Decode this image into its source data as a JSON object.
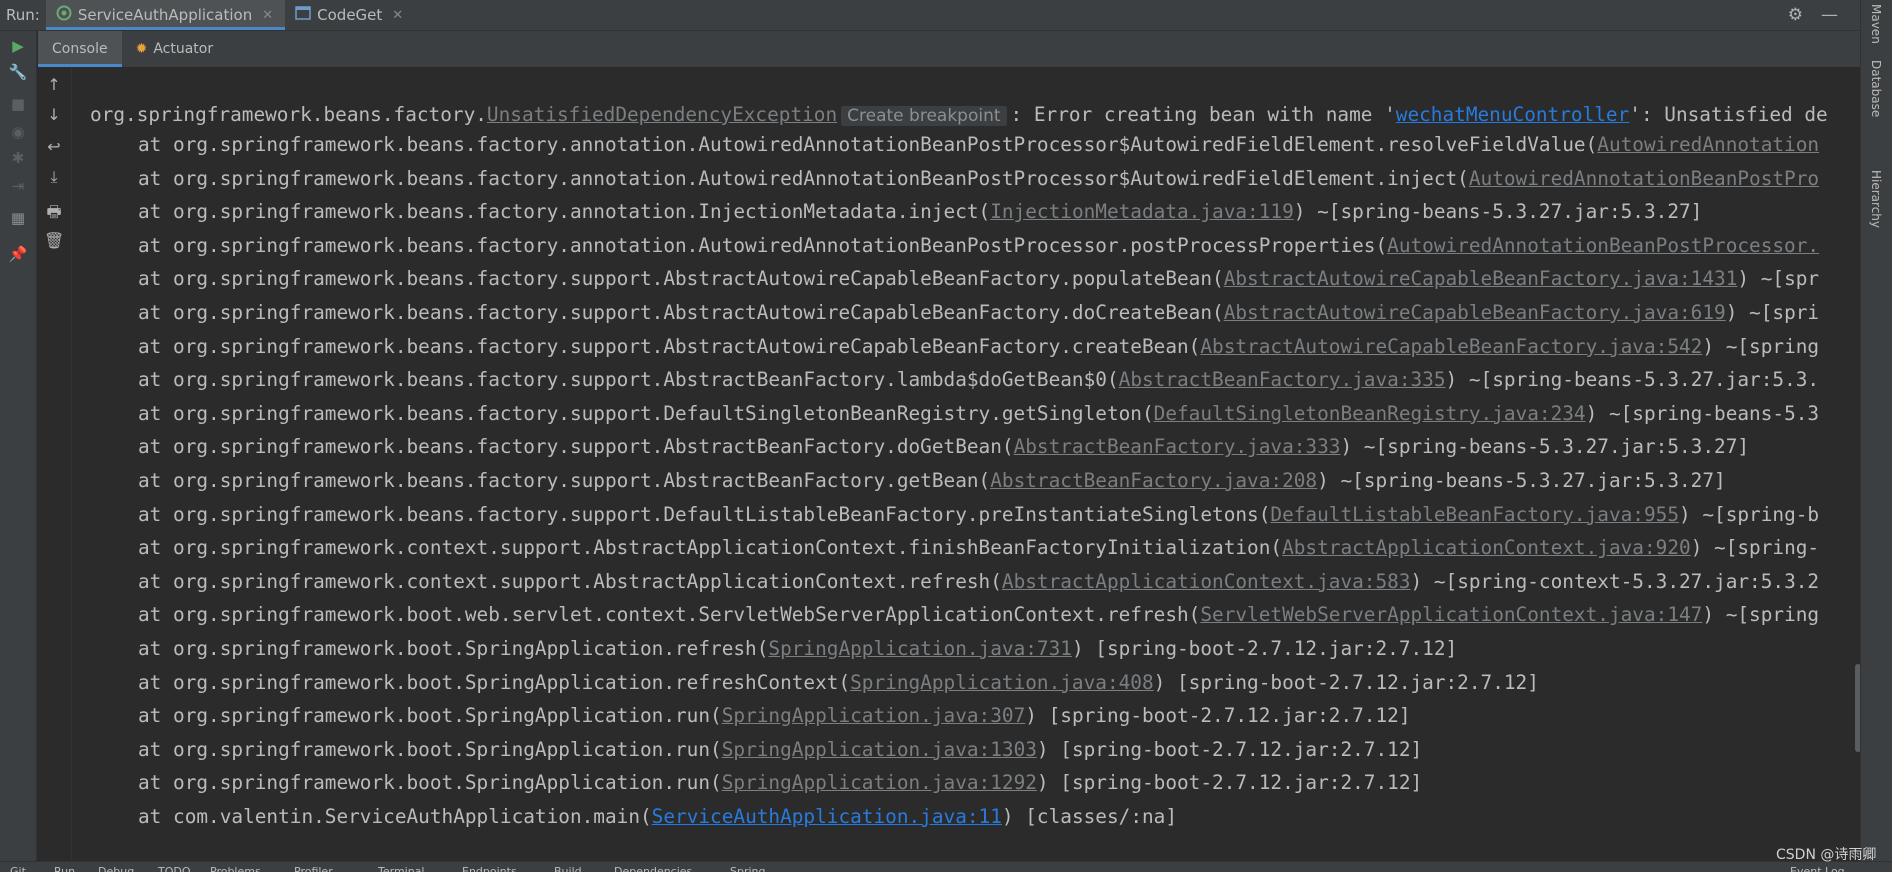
{
  "runbar": {
    "label": "Run:",
    "tabs": [
      {
        "label": "ServiceAuthApplication",
        "active": true
      },
      {
        "label": "CodeGet",
        "active": false
      }
    ]
  },
  "subtabs": [
    {
      "label": "Console",
      "active": true
    },
    {
      "label": "Actuator",
      "active": false
    }
  ],
  "right_stripe": [
    "Maven",
    "Database",
    "Hierarchy"
  ],
  "console": {
    "tooltip": "Create breakpoint",
    "first_line": {
      "prefix": "org.springframework.beans.factory.",
      "exception_link": "UnsatisfiedDependencyException",
      "mid": ": Error creating bean with name '",
      "bean_link": "wechatMenuController",
      "suffix": "': Unsatisfied de"
    },
    "stack": [
      {
        "at": "at org.springframework.beans.factory.annotation.AutowiredAnnotationBeanPostProcessor$AutowiredFieldElement.resolveFieldValue(",
        "link": "AutowiredAnnotation",
        "rest": ""
      },
      {
        "at": "at org.springframework.beans.factory.annotation.AutowiredAnnotationBeanPostProcessor$AutowiredFieldElement.inject(",
        "link": "AutowiredAnnotationBeanPostPro",
        "rest": ""
      },
      {
        "at": "at org.springframework.beans.factory.annotation.InjectionMetadata.inject(",
        "link": "InjectionMetadata.java:119",
        "rest": ") ~[spring-beans-5.3.27.jar:5.3.27]"
      },
      {
        "at": "at org.springframework.beans.factory.annotation.AutowiredAnnotationBeanPostProcessor.postProcessProperties(",
        "link": "AutowiredAnnotationBeanPostProcessor.",
        "rest": ""
      },
      {
        "at": "at org.springframework.beans.factory.support.AbstractAutowireCapableBeanFactory.populateBean(",
        "link": "AbstractAutowireCapableBeanFactory.java:1431",
        "rest": ") ~[spr"
      },
      {
        "at": "at org.springframework.beans.factory.support.AbstractAutowireCapableBeanFactory.doCreateBean(",
        "link": "AbstractAutowireCapableBeanFactory.java:619",
        "rest": ") ~[spri"
      },
      {
        "at": "at org.springframework.beans.factory.support.AbstractAutowireCapableBeanFactory.createBean(",
        "link": "AbstractAutowireCapableBeanFactory.java:542",
        "rest": ") ~[spring"
      },
      {
        "at": "at org.springframework.beans.factory.support.AbstractBeanFactory.lambda$doGetBean$0(",
        "link": "AbstractBeanFactory.java:335",
        "rest": ") ~[spring-beans-5.3.27.jar:5.3."
      },
      {
        "at": "at org.springframework.beans.factory.support.DefaultSingletonBeanRegistry.getSingleton(",
        "link": "DefaultSingletonBeanRegistry.java:234",
        "rest": ") ~[spring-beans-5.3"
      },
      {
        "at": "at org.springframework.beans.factory.support.AbstractBeanFactory.doGetBean(",
        "link": "AbstractBeanFactory.java:333",
        "rest": ") ~[spring-beans-5.3.27.jar:5.3.27]"
      },
      {
        "at": "at org.springframework.beans.factory.support.AbstractBeanFactory.getBean(",
        "link": "AbstractBeanFactory.java:208",
        "rest": ") ~[spring-beans-5.3.27.jar:5.3.27]"
      },
      {
        "at": "at org.springframework.beans.factory.support.DefaultListableBeanFactory.preInstantiateSingletons(",
        "link": "DefaultListableBeanFactory.java:955",
        "rest": ") ~[spring-b"
      },
      {
        "at": "at org.springframework.context.support.AbstractApplicationContext.finishBeanFactoryInitialization(",
        "link": "AbstractApplicationContext.java:920",
        "rest": ") ~[spring-"
      },
      {
        "at": "at org.springframework.context.support.AbstractApplicationContext.refresh(",
        "link": "AbstractApplicationContext.java:583",
        "rest": ") ~[spring-context-5.3.27.jar:5.3.2"
      },
      {
        "at": "at org.springframework.boot.web.servlet.context.ServletWebServerApplicationContext.refresh(",
        "link": "ServletWebServerApplicationContext.java:147",
        "rest": ") ~[spring"
      },
      {
        "at": "at org.springframework.boot.SpringApplication.refresh(",
        "link": "SpringApplication.java:731",
        "rest": ") [spring-boot-2.7.12.jar:2.7.12]"
      },
      {
        "at": "at org.springframework.boot.SpringApplication.refreshContext(",
        "link": "SpringApplication.java:408",
        "rest": ") [spring-boot-2.7.12.jar:2.7.12]"
      },
      {
        "at": "at org.springframework.boot.SpringApplication.run(",
        "link": "SpringApplication.java:307",
        "rest": ") [spring-boot-2.7.12.jar:2.7.12]"
      },
      {
        "at": "at org.springframework.boot.SpringApplication.run(",
        "link": "SpringApplication.java:1303",
        "rest": ") [spring-boot-2.7.12.jar:2.7.12]"
      },
      {
        "at": "at org.springframework.boot.SpringApplication.run(",
        "link": "SpringApplication.java:1292",
        "rest": ") [spring-boot-2.7.12.jar:2.7.12]"
      },
      {
        "at": "at com.valentin.ServiceAuthApplication.main(",
        "link": "ServiceAuthApplication.java:11",
        "rest": ") [classes/:na]",
        "main": true
      }
    ]
  },
  "bottombar": [
    "Git",
    "Run",
    "Debug",
    "TODO",
    "Problems",
    "Profiler",
    "Terminal",
    "Endpoints",
    "Build",
    "Dependencies",
    "Spring",
    "Event Log"
  ],
  "watermark": "CSDN @诗雨卿"
}
